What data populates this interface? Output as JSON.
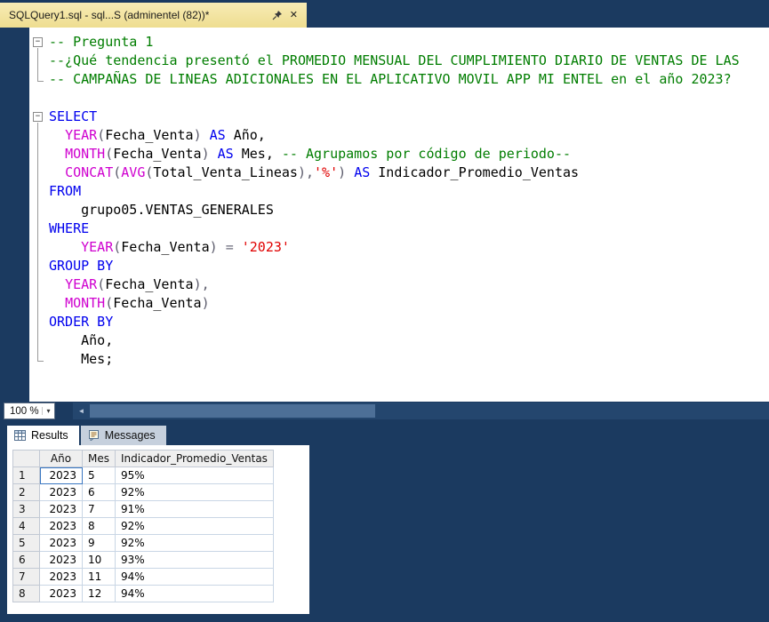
{
  "window": {
    "tab_title": "SQLQuery1.sql - sql...S (adminentel (82))*",
    "close_glyph": "✕"
  },
  "editor": {
    "zoom": "100 %",
    "scroll_left_glyph": "◄",
    "lines": [
      {
        "m": "box",
        "t": [
          [
            "c",
            "-- Pregunta 1"
          ]
        ]
      },
      {
        "m": "line",
        "t": [
          [
            "c",
            "--¿Qué tendencia presentó el PROMEDIO MENSUAL DEL CUMPLIMIENTO DIARIO DE VENTAS DE LAS"
          ]
        ]
      },
      {
        "m": "end",
        "t": [
          [
            "c",
            "-- CAMPAÑAS DE LINEAS ADICIONALES EN EL APLICATIVO MOVIL APP MI ENTEL en el año 2023?"
          ]
        ]
      },
      {
        "m": "none",
        "t": []
      },
      {
        "m": "box",
        "t": [
          [
            "k",
            "SELECT"
          ]
        ]
      },
      {
        "m": "line",
        "t": [
          [
            "t",
            "  "
          ],
          [
            "f",
            "YEAR"
          ],
          [
            "p",
            "("
          ],
          [
            "t",
            "Fecha_Venta"
          ],
          [
            "p",
            ") "
          ],
          [
            "k",
            "AS"
          ],
          [
            "t",
            " Año,"
          ]
        ]
      },
      {
        "m": "line",
        "t": [
          [
            "t",
            "  "
          ],
          [
            "f",
            "MONTH"
          ],
          [
            "p",
            "("
          ],
          [
            "t",
            "Fecha_Venta"
          ],
          [
            "p",
            ") "
          ],
          [
            "k",
            "AS"
          ],
          [
            "t",
            " Mes, "
          ],
          [
            "c",
            "-- Agrupamos por código de periodo--"
          ]
        ]
      },
      {
        "m": "line",
        "t": [
          [
            "t",
            "  "
          ],
          [
            "f",
            "CONCAT"
          ],
          [
            "p",
            "("
          ],
          [
            "f",
            "AVG"
          ],
          [
            "p",
            "("
          ],
          [
            "t",
            "Total_Venta_Lineas"
          ],
          [
            "p",
            "),"
          ],
          [
            "s",
            "'%'"
          ],
          [
            "p",
            ") "
          ],
          [
            "k",
            "AS"
          ],
          [
            "t",
            " Indicador_Promedio_Ventas"
          ]
        ]
      },
      {
        "m": "line",
        "t": [
          [
            "k",
            "FROM"
          ]
        ]
      },
      {
        "m": "line",
        "t": [
          [
            "t",
            "    grupo05.VENTAS_GENERALES"
          ]
        ]
      },
      {
        "m": "line",
        "t": [
          [
            "k",
            "WHERE"
          ]
        ]
      },
      {
        "m": "line",
        "t": [
          [
            "t",
            "    "
          ],
          [
            "f",
            "YEAR"
          ],
          [
            "p",
            "("
          ],
          [
            "t",
            "Fecha_Venta"
          ],
          [
            "p",
            ")"
          ],
          [
            "t",
            " "
          ],
          [
            "o",
            "="
          ],
          [
            "t",
            " "
          ],
          [
            "s",
            "'2023'"
          ]
        ]
      },
      {
        "m": "line",
        "t": [
          [
            "k",
            "GROUP BY"
          ]
        ]
      },
      {
        "m": "line",
        "t": [
          [
            "t",
            "  "
          ],
          [
            "f",
            "YEAR"
          ],
          [
            "p",
            "("
          ],
          [
            "t",
            "Fecha_Venta"
          ],
          [
            "p",
            "),"
          ]
        ]
      },
      {
        "m": "line",
        "t": [
          [
            "t",
            "  "
          ],
          [
            "f",
            "MONTH"
          ],
          [
            "p",
            "("
          ],
          [
            "t",
            "Fecha_Venta"
          ],
          [
            "p",
            ")"
          ]
        ]
      },
      {
        "m": "line",
        "t": [
          [
            "k",
            "ORDER BY"
          ]
        ]
      },
      {
        "m": "line",
        "t": [
          [
            "t",
            "    Año,"
          ]
        ]
      },
      {
        "m": "end",
        "t": [
          [
            "t",
            "    Mes;"
          ]
        ]
      }
    ]
  },
  "results": {
    "tabs": [
      "Results",
      "Messages"
    ],
    "grid": {
      "columns": [
        "Año",
        "Mes",
        "Indicador_Promedio_Ventas"
      ],
      "rows": [
        [
          "1",
          "2023",
          "5",
          "95%"
        ],
        [
          "2",
          "2023",
          "6",
          "92%"
        ],
        [
          "3",
          "2023",
          "7",
          "91%"
        ],
        [
          "4",
          "2023",
          "8",
          "92%"
        ],
        [
          "5",
          "2023",
          "9",
          "92%"
        ],
        [
          "6",
          "2023",
          "10",
          "93%"
        ],
        [
          "7",
          "2023",
          "11",
          "94%"
        ],
        [
          "8",
          "2023",
          "12",
          "94%"
        ]
      ],
      "selected_cell": {
        "row": 0,
        "col": "ano"
      }
    }
  },
  "colors": {
    "frame": "#1b3a60",
    "tab_active": "#f2e3a1",
    "keyword": "#0000ee",
    "comment": "#007d00",
    "function": "#cf00cf",
    "string": "#e00000"
  }
}
